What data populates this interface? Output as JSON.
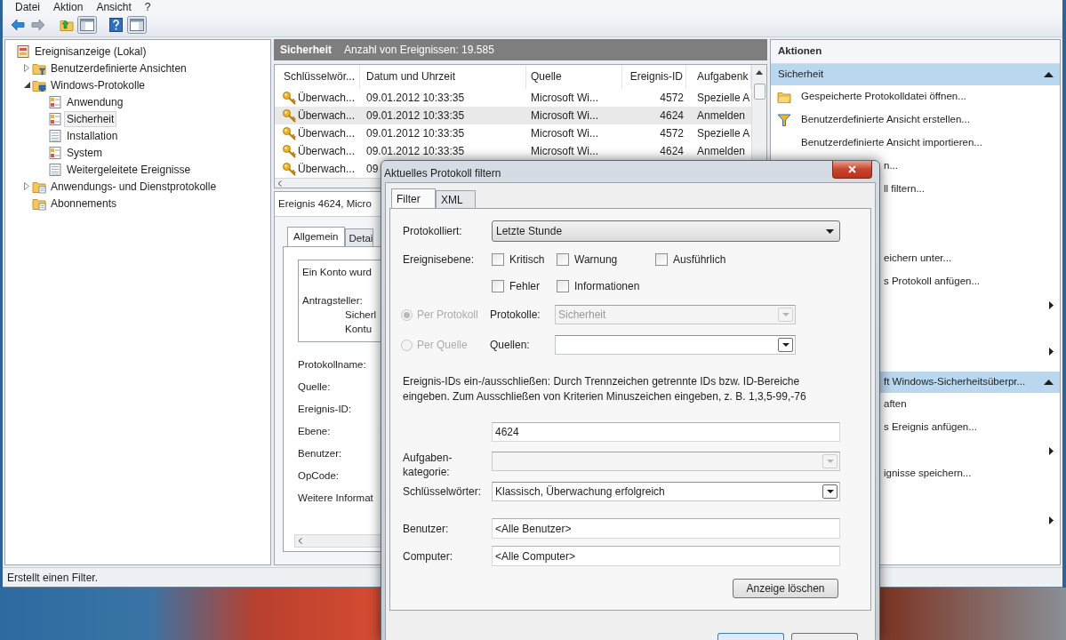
{
  "window": {
    "menu": [
      "Datei",
      "Aktion",
      "Ansicht",
      "?"
    ]
  },
  "tree": [
    {
      "label": "Ereignisanzeige (Lokal)",
      "kind": "viewer",
      "selected": false,
      "children": [
        {
          "label": "Benutzerdefinierte Ansichten",
          "kind": "custom-folder",
          "selected": false,
          "expanded": false
        },
        {
          "label": "Windows-Protokolle",
          "kind": "windows-folder",
          "selected": false,
          "expanded": true,
          "children": [
            {
              "label": "Anwendung",
              "kind": "log",
              "selected": false
            },
            {
              "label": "Sicherheit",
              "kind": "log",
              "selected": true
            },
            {
              "label": "Installation",
              "kind": "plain-log",
              "selected": false
            },
            {
              "label": "System",
              "kind": "log",
              "selected": false
            },
            {
              "label": "Weitergeleitete Ereignisse",
              "kind": "plain-log",
              "selected": false
            }
          ]
        },
        {
          "label": "Anwendungs- und Dienstprotokolle",
          "kind": "folder",
          "selected": false,
          "expanded": false
        },
        {
          "label": "Abonnements",
          "kind": "subscriptions",
          "selected": false
        }
      ]
    }
  ],
  "log_header": {
    "name": "Sicherheit",
    "count": "Anzahl von Ereignissen: 19.585"
  },
  "events": {
    "columns": [
      "Schlüsselwör...",
      "Datum und Uhrzeit",
      "Quelle",
      "Ereignis-ID",
      "Aufgabenk"
    ],
    "rows": [
      {
        "kind": "audit-success",
        "selected": false,
        "cells": [
          "Überwach...",
          "09.01.2012 10:33:35",
          "Microsoft Wi...",
          "4572",
          "Spezielle A"
        ]
      },
      {
        "kind": "audit-success",
        "selected": true,
        "cells": [
          "Überwach...",
          "09.01.2012 10:33:35",
          "Microsoft Wi...",
          "4624",
          "Anmelden"
        ]
      },
      {
        "kind": "audit-success",
        "selected": false,
        "cells": [
          "Überwach...",
          "09.01.2012 10:33:35",
          "Microsoft Wi...",
          "4572",
          "Spezielle A"
        ]
      },
      {
        "kind": "audit-success",
        "selected": false,
        "cells": [
          "Überwach...",
          "09.01.2012 10:33:35",
          "Microsoft Wi...",
          "4624",
          "Anmelden"
        ]
      },
      {
        "kind": "audit-success",
        "selected": false,
        "cells": [
          "Überwach...",
          "09"
        ]
      }
    ]
  },
  "detail": {
    "title": "Ereignis 4624, Micro",
    "tabs": [
      {
        "label": "Allgemein",
        "selected": true
      },
      {
        "label": "Detai",
        "selected": false
      }
    ],
    "description": {
      "lines": [
        "Ein Konto wurd"
      ],
      "section": {
        "label": "Antragsteller:",
        "values": [
          "Sicherl",
          "Kontu"
        ]
      }
    },
    "fields": [
      "Protokollname:",
      "Quelle:",
      "Ereignis-ID:",
      "Ebene:",
      "Benutzer:",
      "OpCode:",
      "Weitere Informat"
    ]
  },
  "actions": {
    "title": "Aktionen",
    "sections": [
      {
        "title": "Sicherheit",
        "expanded": true,
        "items": [
          {
            "kind": "folder",
            "label": "Gespeicherte Protokolldatei öffnen..."
          },
          {
            "kind": "filter",
            "label": "Benutzerdefinierte Ansicht erstellen..."
          },
          {
            "kind": "text",
            "label": "Benutzerdefinierte Ansicht importieren..."
          }
        ],
        "items_beside_dialog": [
          {
            "label": "n..."
          },
          {
            "label": "ll filtern..."
          },
          {
            "label": "eichern unter..."
          },
          {
            "label": "s Protokoll anfügen..."
          },
          {
            "submenu": true
          },
          {
            "submenu": true
          }
        ]
      },
      {
        "title_beside_dialog": "ft Windows-Sicherheitsüberpr...",
        "expanded": true,
        "items_beside_dialog": [
          {
            "label": "aften"
          },
          {
            "label": "s Ereignis anfügen..."
          },
          {
            "submenu": true
          },
          {
            "label": "ignisse speichern..."
          },
          {
            "submenu": true
          }
        ]
      }
    ]
  },
  "status_bar": "Erstellt einen Filter.",
  "dialog": {
    "title": "Aktuelles Protokoll filtern",
    "tabs": [
      {
        "label": "Filter",
        "selected": true
      },
      {
        "label": "XML",
        "selected": false
      }
    ],
    "logged": {
      "label": "Protokolliert:",
      "value": "Letzte Stunde"
    },
    "levels": {
      "label": "Ereignisebene:",
      "rows": [
        {
          "options": [
            {
              "label": "Kritisch",
              "checked": false
            },
            {
              "label": "Warnung",
              "checked": false
            },
            {
              "label": "Ausführlich",
              "checked": false
            }
          ]
        },
        {
          "options": [
            {
              "label": "Fehler",
              "checked": false
            },
            {
              "label": "Informationen",
              "checked": false
            }
          ]
        }
      ]
    },
    "scope": [
      {
        "label": "Per Protokoll",
        "selected": true,
        "disabled": true,
        "field": {
          "label": "Protokolle:",
          "value": "Sicherheit",
          "disabled": true
        }
      },
      {
        "label": "Per Quelle",
        "selected": false,
        "disabled": true,
        "field": {
          "label": "Quellen:",
          "disabled": false
        }
      }
    ],
    "id_hint": "Ereignis-IDs ein-/ausschließen: Durch Trennzeichen getrennte IDs bzw. ID-Bereiche eingeben. Zum Ausschließen von Kriterien Minuszeichen eingeben, z. B. 1,3,5-99,-76",
    "event_ids": "4624",
    "task_category": {
      "label": "Aufgaben-kategorie:",
      "disabled": true
    },
    "keywords": {
      "label": "Schlüsselwörter:",
      "value": "Klassisch, Überwachung erfolgreich",
      "disabled": false
    },
    "user": {
      "label": "Benutzer:",
      "value": "<Alle Benutzer>"
    },
    "computer": {
      "label": "Computer:",
      "value": "<Alle Computer>"
    },
    "clear_button": "Anzeige löschen",
    "footer_buttons": [
      {
        "default": true
      },
      {
        "default": false
      }
    ]
  }
}
